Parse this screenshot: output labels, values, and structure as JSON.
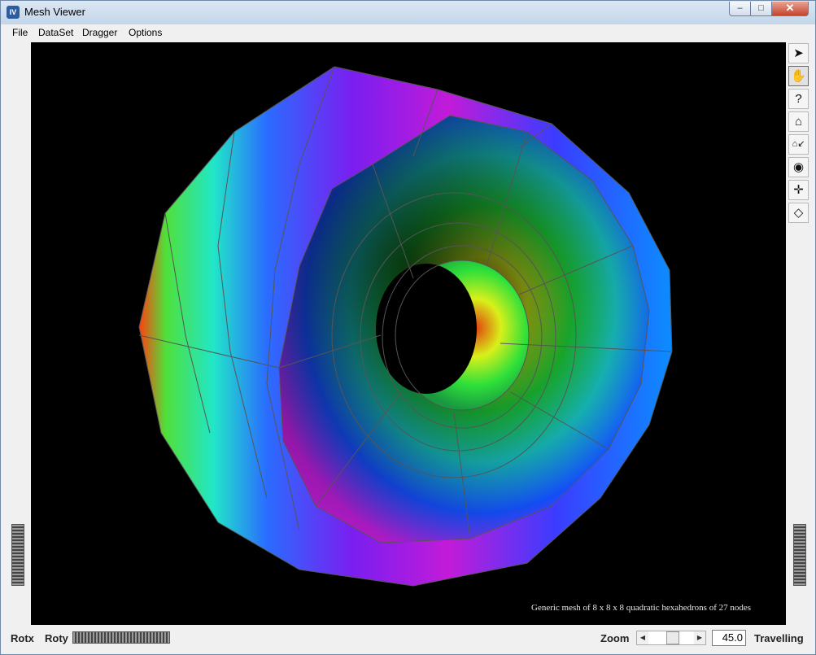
{
  "window": {
    "title": "Mesh Viewer",
    "icon": "IV",
    "minimize": "–",
    "maximize": "□",
    "close": "✕"
  },
  "menu": [
    "File",
    "DataSet",
    "Dragger",
    "Options"
  ],
  "toolbar": {
    "tools": [
      "pick-arrow-icon",
      "view-hand-icon",
      "help-question-icon",
      "home-icon",
      "set-home-icon",
      "view-all-eye-icon",
      "seek-target-icon",
      "projection-cube-icon"
    ],
    "glyphs": [
      "➤",
      "✋",
      "?",
      "⌂",
      "⌂↙",
      "◉",
      "✛",
      "◇"
    ]
  },
  "viewport": {
    "caption": "Generic mesh of 8 x 8 x 8 quadratic hexahedrons of 27 nodes",
    "background": "#000000"
  },
  "bottom": {
    "rotx": "Rotx",
    "roty": "Roty",
    "zoom_label": "Zoom",
    "zoom_value": "45.0",
    "mode": "Travelling",
    "left_arrow": "◀",
    "right_arrow": "▶"
  }
}
